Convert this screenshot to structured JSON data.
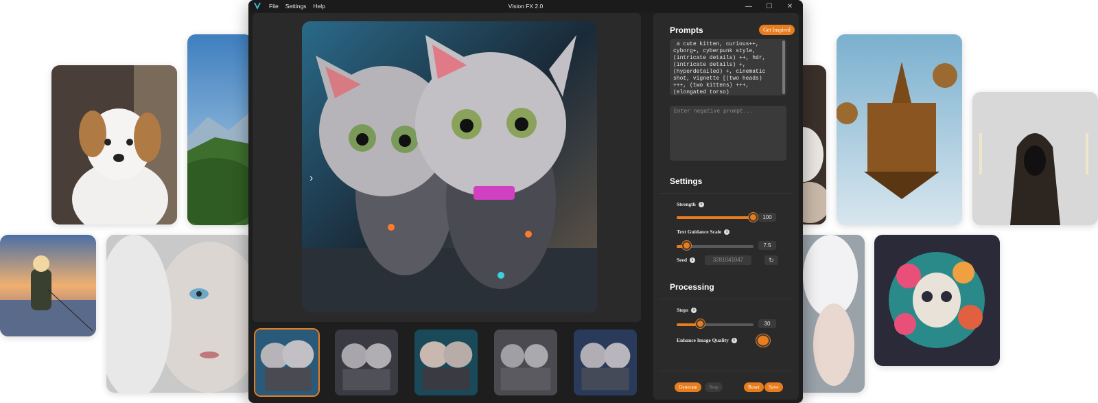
{
  "window": {
    "title": "Vision FX 2.0",
    "menu": [
      "File",
      "Settings",
      "Help"
    ],
    "controls": {
      "minimize": "—",
      "maximize": "☐",
      "close": "✕"
    }
  },
  "preview": {
    "nav_arrow": "›",
    "thumbnails_count": 5,
    "selected_thumbnail": 1
  },
  "prompts": {
    "title": "Prompts",
    "inspire_label": "Get Inspired",
    "prompt_text": " a cute kitten, curious++, cyborg+, cyberpunk style, (intricate details) ++, hdr, (intricate details) +, (hyperdetailed) +, cinematic shot, vignette [(two heads) +++, (two kittens) +++, (elongated torso)",
    "negative_placeholder": "Enter negative prompt..."
  },
  "settings": {
    "title": "Settings",
    "strength": {
      "label": "Strength",
      "value": "100",
      "fraction": 1.0
    },
    "guidance": {
      "label": "Text Guidance Scale",
      "value": "7.5",
      "fraction": 0.12
    },
    "seed": {
      "label": "Seed",
      "value": "3281041047",
      "refresh_icon": "↻"
    }
  },
  "processing": {
    "title": "Processing",
    "steps": {
      "label": "Steps",
      "value": "30",
      "fraction": 0.3
    },
    "enhance": {
      "label": "Enhance Image Quality",
      "on": true
    }
  },
  "actions": {
    "generate": "Generate",
    "stop": "Stop",
    "reset": "Reset",
    "save": "Save"
  },
  "colors": {
    "accent": "#e87d1e",
    "panel": "#2a2a2a",
    "window": "#1e1e1e"
  },
  "info_icon": "i"
}
